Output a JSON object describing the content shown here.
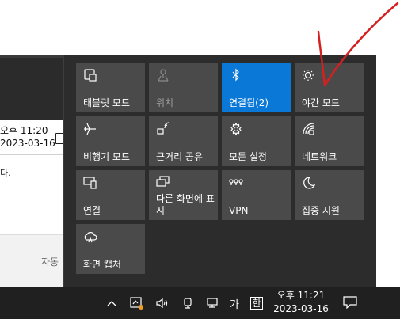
{
  "background": {
    "time": "오후 11:20",
    "date": "2023-03-16",
    "snippet": "다.",
    "footer_text": "자동"
  },
  "quick_actions": [
    {
      "key": "tablet_mode",
      "label": "태블릿 모드",
      "icon": "tablet-mode-icon",
      "active": false,
      "disabled": false
    },
    {
      "key": "location",
      "label": "위치",
      "icon": "location-icon",
      "active": false,
      "disabled": true
    },
    {
      "key": "bluetooth",
      "label": "연결됨(2)",
      "icon": "bluetooth-icon",
      "active": true,
      "disabled": false
    },
    {
      "key": "night_light",
      "label": "야간 모드",
      "icon": "night-light-icon",
      "active": false,
      "disabled": false
    },
    {
      "key": "airplane_mode",
      "label": "비행기 모드",
      "icon": "airplane-icon",
      "active": false,
      "disabled": false
    },
    {
      "key": "nearby_sharing",
      "label": "근거리 공유",
      "icon": "nearby-sharing-icon",
      "active": false,
      "disabled": false
    },
    {
      "key": "all_settings",
      "label": "모든 설정",
      "icon": "gear-icon",
      "active": false,
      "disabled": false
    },
    {
      "key": "network",
      "label": "네트워크",
      "icon": "network-icon",
      "active": false,
      "disabled": false
    },
    {
      "key": "connect",
      "label": "연결",
      "icon": "connect-icon",
      "active": false,
      "disabled": false
    },
    {
      "key": "project",
      "label": "다른 화면에 표시",
      "icon": "project-icon",
      "active": false,
      "disabled": false
    },
    {
      "key": "vpn",
      "label": "VPN",
      "icon": "vpn-icon",
      "active": false,
      "disabled": false
    },
    {
      "key": "focus_assist",
      "label": "집중 지원",
      "icon": "moon-icon",
      "active": false,
      "disabled": false
    },
    {
      "key": "screen_snip",
      "label": "화면 캡처",
      "icon": "screen-snip-icon",
      "active": false,
      "disabled": false
    }
  ],
  "taskbar": {
    "ime_mode": "가",
    "ime_lang": "한",
    "time": "오후 11:21",
    "date": "2023-03-16"
  },
  "colors": {
    "panel_bg": "#2c2c2c",
    "tile_bg": "#4a4a4a",
    "tile_active": "#0a78d7",
    "taskbar_bg": "#202020",
    "annotation": "#d42020"
  }
}
